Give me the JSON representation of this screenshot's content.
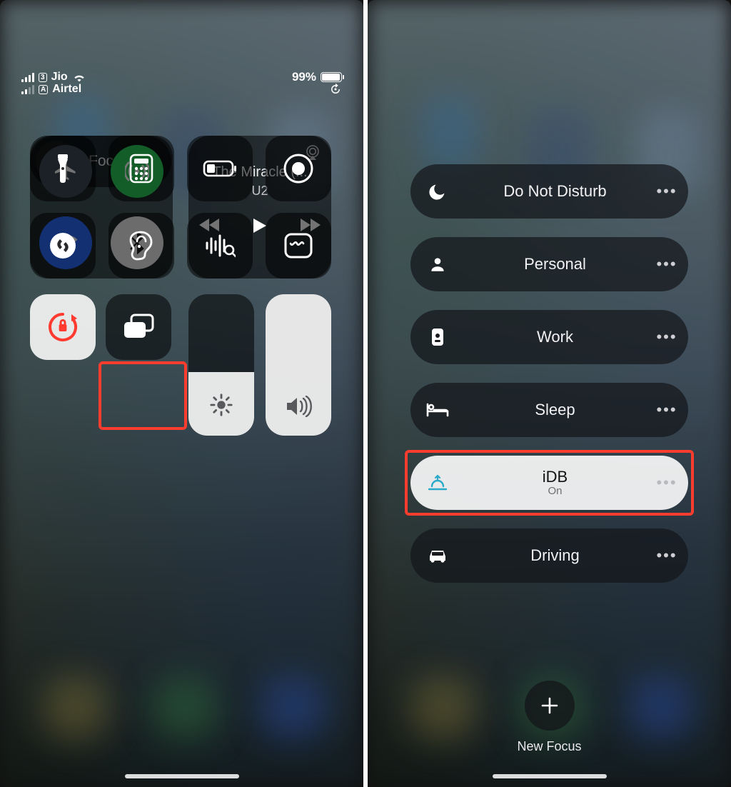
{
  "left": {
    "status": {
      "sim1_carrier": "Jio",
      "sim2_carrier": "Airtel",
      "sim1_badge": "3",
      "sim2_badge": "A",
      "battery_pct": "99%"
    },
    "music": {
      "title": "The Miracle (...",
      "artist": "U2"
    },
    "focus_label": "Focus"
  },
  "right": {
    "modes": {
      "dnd": {
        "label": "Do Not Disturb"
      },
      "personal": {
        "label": "Personal"
      },
      "work": {
        "label": "Work"
      },
      "sleep": {
        "label": "Sleep"
      },
      "idb": {
        "label": "iDB",
        "sub": "On"
      },
      "driving": {
        "label": "Driving"
      },
      "more_glyph": "•••"
    },
    "new_focus_label": "New Focus"
  }
}
